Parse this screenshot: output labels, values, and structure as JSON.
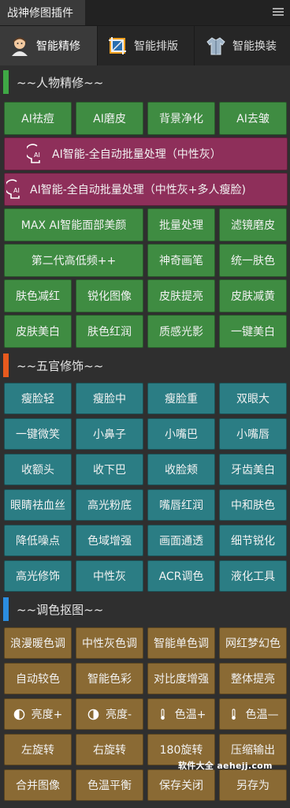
{
  "panel": {
    "title": "战神修图插件",
    "menu_icon": "hamburger-menu-icon"
  },
  "tabs": [
    {
      "label": "智能精修",
      "icon": "avatar-portrait-icon",
      "active": true
    },
    {
      "label": "智能排版",
      "icon": "crop-layout-icon",
      "active": false
    },
    {
      "label": "智能换装",
      "icon": "shirt-icon",
      "active": false
    }
  ],
  "sections": {
    "people": {
      "label": "~~人物精修~~",
      "color": "#3fa845"
    },
    "features": {
      "label": "~~五官修饰~~",
      "color": "#e85a1e"
    },
    "color": {
      "label": "~~调色抠图~~",
      "color": "#2b8de0"
    }
  },
  "people_buttons": {
    "row1": [
      "AI祛痘",
      "AI磨皮",
      "背景净化",
      "AI去皱"
    ],
    "ai_batch_1": "AI智能-全自动批量处理（中性灰）",
    "ai_batch_2": "AI智能-全自动批量处理（中性灰+多人瘦脸)",
    "row2": [
      "MAX AI智能面部美颜",
      "批量处理",
      "滤镜磨皮"
    ],
    "row3": [
      "第二代高低频++",
      "神奇画笔",
      "统一肤色"
    ],
    "row4": [
      "肤色减红",
      "锐化图像",
      "皮肤提亮",
      "皮肤减黄"
    ],
    "row5": [
      "皮肤美白",
      "肤色红润",
      "质感光影",
      "一键美白"
    ]
  },
  "feature_buttons": {
    "row1": [
      "瘦脸轻",
      "瘦脸中",
      "瘦脸重",
      "双眼大"
    ],
    "row2": [
      "一键微笑",
      "小鼻子",
      "小嘴巴",
      "小嘴唇"
    ],
    "row3": [
      "收额头",
      "收下巴",
      "收脸颊",
      "牙齿美白"
    ],
    "row4": [
      "眼睛祛血丝",
      "高光粉底",
      "嘴唇红润",
      "中和肤色"
    ],
    "row5": [
      "降低噪点",
      "色域增强",
      "画面通透",
      "细节锐化"
    ],
    "row6": [
      "高光修饰",
      "中性灰",
      "ACR调色",
      "液化工具"
    ]
  },
  "color_buttons": {
    "row1": [
      "浪漫暖色调",
      "中性灰色调",
      "智能单色调",
      "网红梦幻色"
    ],
    "row2": [
      "自动较色",
      "智能色彩",
      "对比度增强",
      "整体提亮"
    ],
    "row3": [
      "亮度+",
      "亮度-",
      "色温+",
      "色温—"
    ],
    "row4": [
      "左旋转",
      "右旋转",
      "180旋转",
      "压缩输出"
    ],
    "row5": [
      "合并图像",
      "色温平衡",
      "保存关闭",
      "另存为"
    ]
  },
  "watermark": "软件大全 aehejj.com"
}
